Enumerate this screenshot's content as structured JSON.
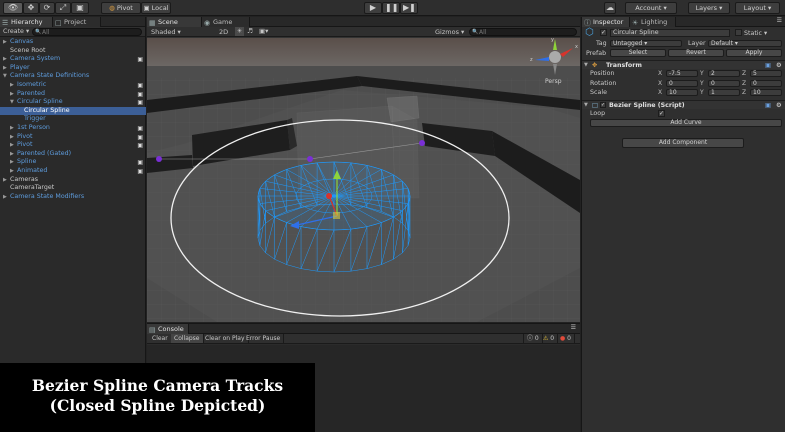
{
  "toolbar": {
    "pivot_label": "Pivot",
    "local_label": "Local",
    "account_label": "Account",
    "layers_label": "Layers",
    "layout_label": "Layout"
  },
  "hierarchy": {
    "tab_label": "Hierarchy",
    "project_tab_label": "Project",
    "create_label": "Create",
    "search_placeholder": "All",
    "items": [
      {
        "label": "Canvas",
        "indent": 0,
        "arrow": "▶",
        "blue": true,
        "eye": false
      },
      {
        "label": "Scene Root",
        "indent": 0,
        "arrow": "",
        "blue": false,
        "eye": false
      },
      {
        "label": "Camera System",
        "indent": 0,
        "arrow": "▶",
        "blue": true,
        "eye": true
      },
      {
        "label": "Player",
        "indent": 0,
        "arrow": "▶",
        "blue": true,
        "eye": false
      },
      {
        "label": "Camera State Definitions",
        "indent": 0,
        "arrow": "▼",
        "blue": true,
        "eye": false
      },
      {
        "label": "Isometric",
        "indent": 1,
        "arrow": "▶",
        "blue": true,
        "eye": true
      },
      {
        "label": "Parented",
        "indent": 1,
        "arrow": "▶",
        "blue": true,
        "eye": true
      },
      {
        "label": "Circular Spline",
        "indent": 1,
        "arrow": "▼",
        "blue": true,
        "eye": true
      },
      {
        "label": "Circular Spline",
        "indent": 2,
        "arrow": "",
        "blue": true,
        "eye": false,
        "selected": true
      },
      {
        "label": "Trigger",
        "indent": 2,
        "arrow": "",
        "blue": true,
        "eye": false
      },
      {
        "label": "1st Person",
        "indent": 1,
        "arrow": "▶",
        "blue": true,
        "eye": true
      },
      {
        "label": "Pivot",
        "indent": 1,
        "arrow": "▶",
        "blue": true,
        "eye": true
      },
      {
        "label": "Pivot",
        "indent": 1,
        "arrow": "▶",
        "blue": true,
        "eye": true
      },
      {
        "label": "Parented (Gated)",
        "indent": 1,
        "arrow": "▶",
        "blue": true,
        "eye": false
      },
      {
        "label": "Spline",
        "indent": 1,
        "arrow": "▶",
        "blue": true,
        "eye": true
      },
      {
        "label": "Animated",
        "indent": 1,
        "arrow": "▶",
        "blue": true,
        "eye": true
      },
      {
        "label": "Cameras",
        "indent": 0,
        "arrow": "▶",
        "blue": false,
        "eye": false
      },
      {
        "label": "CameraTarget",
        "indent": 0,
        "arrow": "",
        "blue": false,
        "eye": false
      },
      {
        "label": "Camera State Modifiers",
        "indent": 0,
        "arrow": "▶",
        "blue": true,
        "eye": false
      }
    ]
  },
  "scene": {
    "scene_tab_label": "Scene",
    "game_tab_label": "Game",
    "shading_label": "Shaded",
    "mode_2d_label": "2D",
    "gizmos_label": "Gizmos",
    "search_placeholder": "All",
    "persp_label": "Persp",
    "gizmo_axes": [
      "y",
      "x",
      "z"
    ]
  },
  "console": {
    "tab_label": "Console",
    "buttons": [
      "Clear",
      "Collapse",
      "Clear on Play",
      "Error Pause"
    ],
    "counts": [
      "0",
      "0",
      "0"
    ]
  },
  "inspector": {
    "tab_label": "Inspector",
    "lighting_tab_label": "Lighting",
    "object_name": "Circular Spline",
    "static_label": "Static",
    "tag_label": "Tag",
    "tag_value": "Untagged",
    "layer_label": "Layer",
    "layer_value": "Default",
    "prefab_label": "Prefab",
    "select_label": "Select",
    "revert_label": "Revert",
    "apply_label": "Apply",
    "transform_title": "Transform",
    "axis_labels": [
      "X",
      "Y",
      "Z"
    ],
    "position_label": "Position",
    "position": [
      "-7.5",
      "2",
      "5"
    ],
    "rotation_label": "Rotation",
    "rotation": [
      "0",
      "0",
      "0"
    ],
    "scale_label": "Scale",
    "scale": [
      "10",
      "1",
      "10"
    ],
    "script_title": "Bezier Spline (Script)",
    "loop_label": "Loop",
    "loop_checked": "✓",
    "add_curve_label": "Add Curve",
    "add_component_label": "Add Component"
  },
  "caption": {
    "line1": "Bezier Spline Camera Tracks",
    "line2": "(Closed Spline Depicted)"
  },
  "colors": {
    "selection": "#3c5f97",
    "blue_text": "#5e9cdd",
    "wire": "#1e9bff",
    "gizmo_y": "#8fd33a",
    "gizmo_x": "#d8342c",
    "gizmo_z": "#2f6fe8",
    "spline_point": "#7a2fd6"
  }
}
